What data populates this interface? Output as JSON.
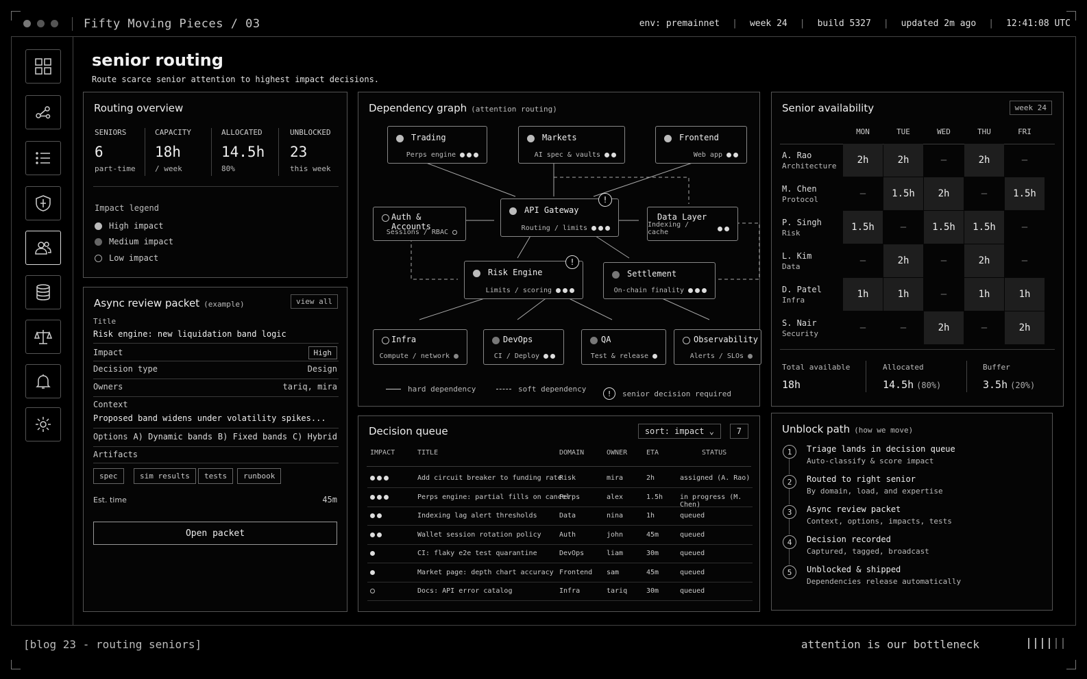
{
  "app": {
    "title": "Fifty Moving Pieces / 03"
  },
  "topbar": {
    "env": "env: premainnet",
    "week": "week 24",
    "build": "build 5327",
    "updated": "updated 2m ago",
    "time": "12:41:08 UTC"
  },
  "nav": [
    {
      "icon": "grid-icon"
    },
    {
      "icon": "graph-icon"
    },
    {
      "icon": "list-icon"
    },
    {
      "icon": "shield-icon"
    },
    {
      "icon": "users-icon",
      "active": true
    },
    {
      "icon": "database-icon"
    },
    {
      "icon": "scales-icon"
    },
    {
      "icon": "bell-icon"
    },
    {
      "icon": "gear-icon"
    }
  ],
  "page": {
    "title": "senior routing",
    "subtitle": "Route scarce senior attention to highest impact decisions."
  },
  "overview": {
    "title": "Routing overview",
    "stats": [
      {
        "label": "SENIORS",
        "value": "6",
        "sub": "part-time"
      },
      {
        "label": "CAPACITY",
        "value": "18h",
        "sub": "/ week"
      },
      {
        "label": "ALLOCATED",
        "value": "14.5h",
        "sub": "80%"
      },
      {
        "label": "UNBLOCKED",
        "value": "23",
        "sub": "this week"
      }
    ],
    "legend_title": "Impact legend",
    "legend": [
      "High impact",
      "Medium impact",
      "Low impact"
    ]
  },
  "packet": {
    "title": "Async review packet",
    "title_note": "(example)",
    "view_all": "view all",
    "title_label": "Title",
    "title_value": "Risk engine: new liquidation band logic",
    "impact_label": "Impact",
    "impact_value": "High",
    "decision_label": "Decision type",
    "decision_value": "Design",
    "owners_label": "Owners",
    "owners_value": "tariq, mira",
    "context_label": "Context",
    "context_value": "Proposed band widens under volatility spikes...",
    "options_label": "Options",
    "options": [
      "A) Dynamic bands",
      "B) Fixed bands",
      "C) Hybrid"
    ],
    "artifacts_label": "Artifacts",
    "artifacts": [
      "spec",
      "sim results",
      "tests",
      "runbook"
    ],
    "est_label": "Est. time",
    "est_value": "45m",
    "open_button": "Open packet"
  },
  "graph": {
    "title": "Dependency graph",
    "title_note": "(attention routing)",
    "nodes": {
      "trading": {
        "name": "Trading",
        "sub": "Perps engine"
      },
      "markets": {
        "name": "Markets",
        "sub": "AI spec & vaults"
      },
      "frontend": {
        "name": "Frontend",
        "sub": "Web app"
      },
      "auth": {
        "name": "Auth & Accounts",
        "sub": "Sessions / RBAC"
      },
      "api": {
        "name": "API Gateway",
        "sub": "Routing / limits"
      },
      "data": {
        "name": "Data Layer",
        "sub": "Indexing / cache"
      },
      "risk": {
        "name": "Risk Engine",
        "sub": "Limits / scoring"
      },
      "settlement": {
        "name": "Settlement",
        "sub": "On-chain finality"
      },
      "infra": {
        "name": "Infra",
        "sub": "Compute / network"
      },
      "devops": {
        "name": "DevOps",
        "sub": "CI / Deploy"
      },
      "qa": {
        "name": "QA",
        "sub": "Test & release"
      },
      "obs": {
        "name": "Observability",
        "sub": "Alerts / SLOs"
      }
    },
    "warn_glyph": "!",
    "legend": {
      "hard": "hard dependency",
      "soft": "soft dependency",
      "senior": "senior decision required"
    }
  },
  "availability": {
    "title": "Senior availability",
    "week_badge": "week 24",
    "days": [
      "MON",
      "TUE",
      "WED",
      "THU",
      "FRI"
    ],
    "people": [
      {
        "name": "A. Rao",
        "role": "Architecture",
        "slots": [
          "2h",
          "2h",
          "—",
          "2h",
          "—"
        ]
      },
      {
        "name": "M. Chen",
        "role": "Protocol",
        "slots": [
          "—",
          "1.5h",
          "2h",
          "—",
          "1.5h"
        ]
      },
      {
        "name": "P. Singh",
        "role": "Risk",
        "slots": [
          "1.5h",
          "—",
          "1.5h",
          "1.5h",
          "—"
        ]
      },
      {
        "name": "L. Kim",
        "role": "Data",
        "slots": [
          "—",
          "2h",
          "—",
          "2h",
          "—"
        ]
      },
      {
        "name": "D. Patel",
        "role": "Infra",
        "slots": [
          "1h",
          "1h",
          "—",
          "1h",
          "1h"
        ]
      },
      {
        "name": "S. Nair",
        "role": "Security",
        "slots": [
          "—",
          "—",
          "2h",
          "—",
          "2h"
        ]
      }
    ],
    "totals": [
      {
        "label": "Total available",
        "value": "18h",
        "note": ""
      },
      {
        "label": "Allocated",
        "value": "14.5h",
        "note": "(80%)"
      },
      {
        "label": "Buffer",
        "value": "3.5h",
        "note": "(20%)"
      }
    ]
  },
  "queue": {
    "title": "Decision queue",
    "sort_label": "sort: impact",
    "count": "7",
    "headers": [
      "IMPACT",
      "TITLE",
      "DOMAIN",
      "OWNER",
      "ETA",
      "STATUS"
    ],
    "rows": [
      {
        "impact": 3,
        "title": "Add circuit breaker to funding rate",
        "domain": "Risk",
        "owner": "mira",
        "eta": "2h",
        "status": "assigned (A. Rao)"
      },
      {
        "impact": 3,
        "title": "Perps engine: partial fills on cancel",
        "domain": "Perps",
        "owner": "alex",
        "eta": "1.5h",
        "status": "in progress (M. Chen)"
      },
      {
        "impact": 2,
        "title": "Indexing lag alert thresholds",
        "domain": "Data",
        "owner": "nina",
        "eta": "1h",
        "status": "queued"
      },
      {
        "impact": 2,
        "title": "Wallet session rotation policy",
        "domain": "Auth",
        "owner": "john",
        "eta": "45m",
        "status": "queued"
      },
      {
        "impact": 1,
        "title": "CI: flaky e2e test quarantine",
        "domain": "DevOps",
        "owner": "liam",
        "eta": "30m",
        "status": "queued"
      },
      {
        "impact": 1,
        "title": "Market page: depth chart accuracy",
        "domain": "Frontend",
        "owner": "sam",
        "eta": "45m",
        "status": "queued"
      },
      {
        "impact": 0,
        "title": "Docs: API error catalog",
        "domain": "Infra",
        "owner": "tariq",
        "eta": "30m",
        "status": "queued"
      }
    ]
  },
  "unblock": {
    "title": "Unblock path",
    "title_note": "(how we move)",
    "steps": [
      {
        "n": "1",
        "title": "Triage lands in decision queue",
        "desc": "Auto-classify & score impact"
      },
      {
        "n": "2",
        "title": "Routed to right senior",
        "desc": "By domain, load, and expertise"
      },
      {
        "n": "3",
        "title": "Async review packet",
        "desc": "Context, options, impacts, tests"
      },
      {
        "n": "4",
        "title": "Decision recorded",
        "desc": "Captured, tagged, broadcast"
      },
      {
        "n": "5",
        "title": "Unblocked & shipped",
        "desc": "Dependencies release automatically"
      }
    ]
  },
  "footer": {
    "left": "[blog 23 - routing seniors]",
    "right": "attention is our bottleneck"
  }
}
